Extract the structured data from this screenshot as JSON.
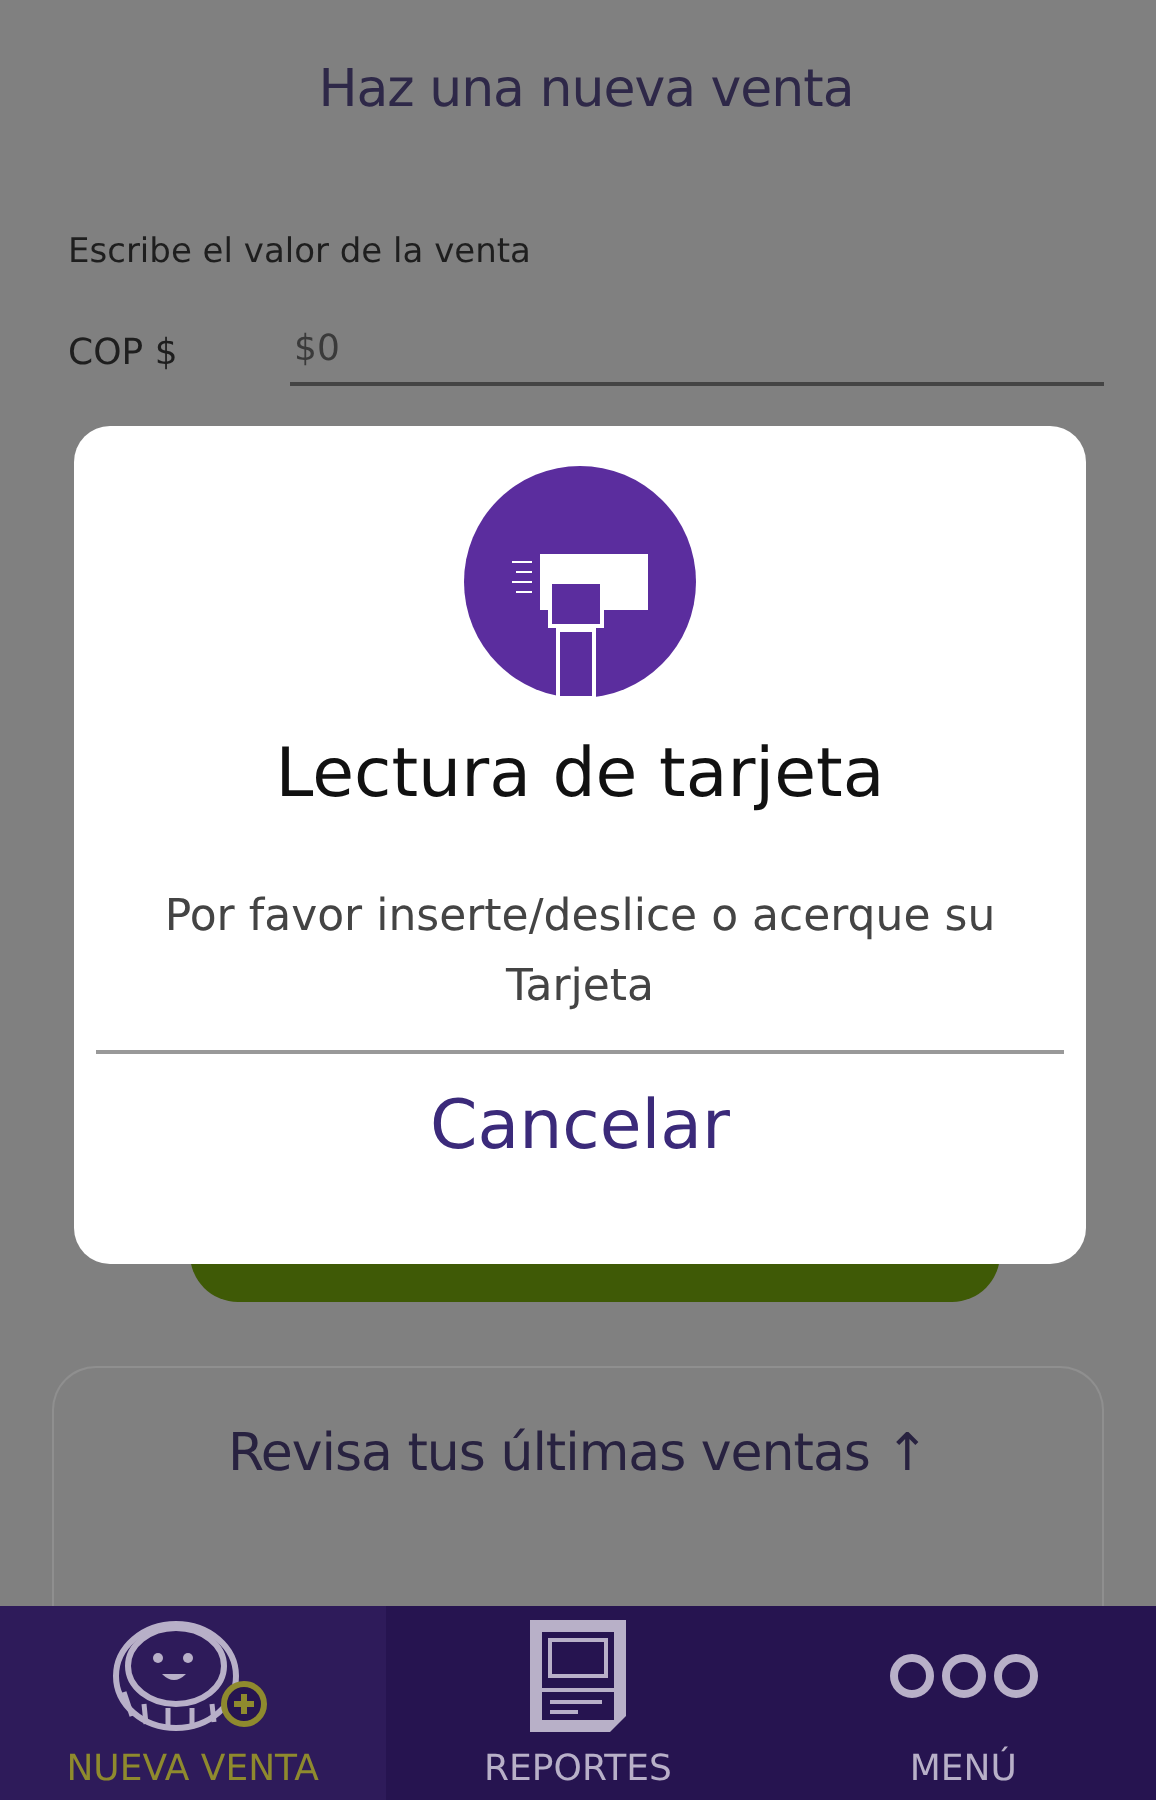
{
  "header": {
    "title": "Haz una nueva venta"
  },
  "amount": {
    "label": "Escribe el valor de la venta",
    "currency": "COP $",
    "placeholder": "$0"
  },
  "recent_sales": {
    "label": "Revisa tus últimas ventas ↑"
  },
  "dialog": {
    "title": "Lectura de tarjeta",
    "message": "Por favor inserte/deslice o acerque su Tarjeta",
    "button": "Cancelar"
  },
  "nav": [
    {
      "kind": "coin",
      "label": "NUEVA VENTA",
      "selected": true
    },
    {
      "kind": "report",
      "label": "REPORTES",
      "selected": false
    },
    {
      "kind": "dots",
      "label": "MENÚ",
      "selected": false
    }
  ]
}
